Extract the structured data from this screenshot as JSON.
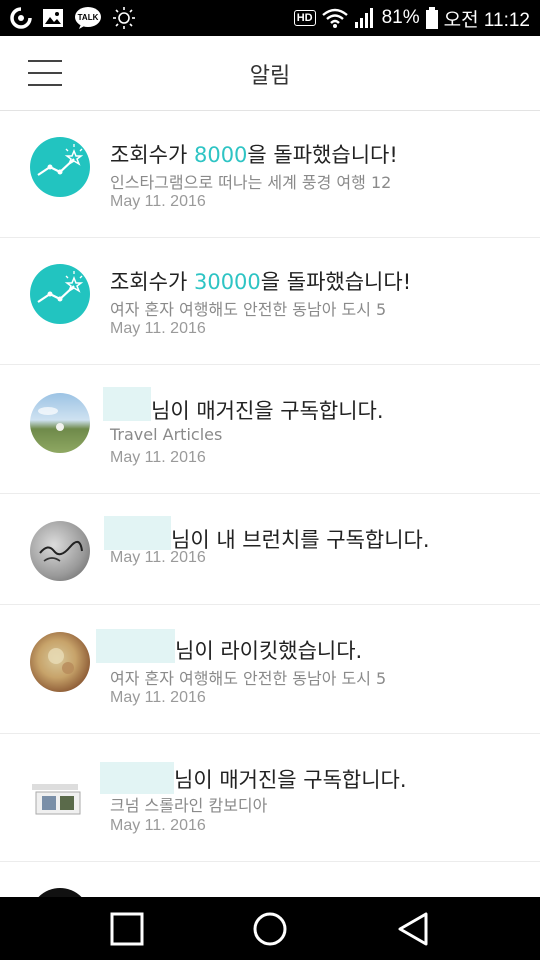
{
  "status_bar": {
    "icons_left": [
      "owl-icon",
      "gallery-icon",
      "kakaotalk-icon",
      "brightness-icon"
    ],
    "talk_label": "TALK",
    "hd_label": "HD",
    "battery": "81%",
    "time": "오전 11:12"
  },
  "app_bar": {
    "title": "알림"
  },
  "notifications": [
    {
      "type": "milestone",
      "title_prefix": "조회수가 ",
      "title_highlight": "8000",
      "title_suffix": "을 돌파했습니다!",
      "subtitle": "인스타그램으로 떠나는 세계 풍경 여행 12",
      "date": "May 11. 2016"
    },
    {
      "type": "milestone",
      "title_prefix": "조회수가 ",
      "title_highlight": "30000",
      "title_suffix": "을 돌파했습니다!",
      "subtitle": "여자 혼자 여행해도 안전한 동남아 도시 5",
      "date": "May 11. 2016"
    },
    {
      "type": "subscribe",
      "title_suffix": "님이 매거진을 구독합니다.",
      "subtitle": "Travel Articles",
      "date": "May 11. 2016"
    },
    {
      "type": "subscribe_brunch",
      "title_suffix": "님이 내 브런치를 구독합니다.",
      "date": "May 11. 2016"
    },
    {
      "type": "like",
      "title_suffix": "님이 라이킷했습니다.",
      "subtitle": "여자 혼자 여행해도 안전한 동남아 도시 5",
      "date": "May 11. 2016"
    },
    {
      "type": "subscribe",
      "title_suffix": "님이 매거진을 구독합니다.",
      "subtitle": "크넘 스롤라인 캄보디아",
      "date": "May 11. 2016"
    }
  ],
  "colors": {
    "accent": "#2ec4c4",
    "statusbar": "#000000",
    "navbar": "#000000"
  },
  "nav_bar": {
    "buttons": [
      "recent-apps-icon",
      "home-icon",
      "back-icon"
    ]
  }
}
